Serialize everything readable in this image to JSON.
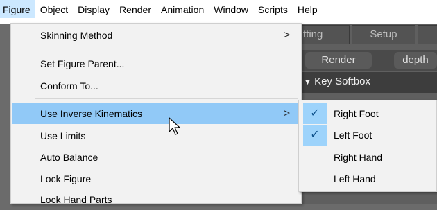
{
  "menubar": {
    "items": [
      "Figure",
      "Object",
      "Display",
      "Render",
      "Animation",
      "Window",
      "Scripts",
      "Help"
    ]
  },
  "background": {
    "tab_partial": "tting",
    "tab_setup": "Setup",
    "render_button": "Render",
    "depth_button": "depth",
    "key_softbox": "Key Softbox"
  },
  "figure_menu": {
    "skinning_method": "Skinning Method",
    "set_figure_parent": "Set Figure Parent...",
    "conform_to": "Conform To...",
    "use_inverse_kinematics": "Use Inverse Kinematics",
    "use_limits": "Use Limits",
    "auto_balance": "Auto Balance",
    "lock_figure": "Lock Figure",
    "lock_hand_parts": "Lock Hand Parts",
    "submenu_arrow": ">"
  },
  "ik_submenu": {
    "right_foot": "Right Foot",
    "left_foot": "Left Foot",
    "right_hand": "Right Hand",
    "left_hand": "Left Hand",
    "checkmark": "✓",
    "checked": [
      "Right Foot",
      "Left Foot"
    ]
  },
  "colors": {
    "highlight": "#91c9f7",
    "menu_active": "#cce8ff",
    "check_bg": "#9dd3fb"
  }
}
